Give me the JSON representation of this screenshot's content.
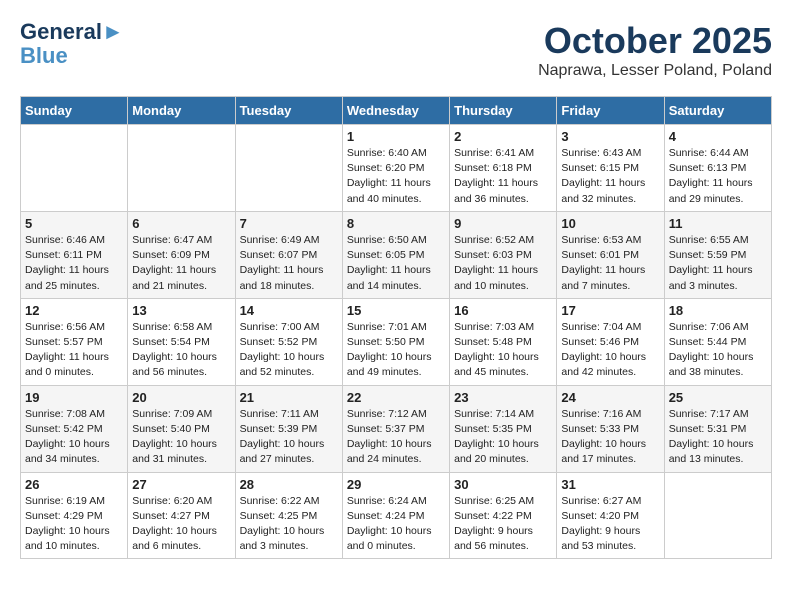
{
  "header": {
    "logo_general": "General",
    "logo_blue": "Blue",
    "month": "October 2025",
    "location": "Naprawa, Lesser Poland, Poland"
  },
  "days_of_week": [
    "Sunday",
    "Monday",
    "Tuesday",
    "Wednesday",
    "Thursday",
    "Friday",
    "Saturday"
  ],
  "weeks": [
    [
      {
        "day": "",
        "content": ""
      },
      {
        "day": "",
        "content": ""
      },
      {
        "day": "",
        "content": ""
      },
      {
        "day": "1",
        "content": "Sunrise: 6:40 AM\nSunset: 6:20 PM\nDaylight: 11 hours\nand 40 minutes."
      },
      {
        "day": "2",
        "content": "Sunrise: 6:41 AM\nSunset: 6:18 PM\nDaylight: 11 hours\nand 36 minutes."
      },
      {
        "day": "3",
        "content": "Sunrise: 6:43 AM\nSunset: 6:15 PM\nDaylight: 11 hours\nand 32 minutes."
      },
      {
        "day": "4",
        "content": "Sunrise: 6:44 AM\nSunset: 6:13 PM\nDaylight: 11 hours\nand 29 minutes."
      }
    ],
    [
      {
        "day": "5",
        "content": "Sunrise: 6:46 AM\nSunset: 6:11 PM\nDaylight: 11 hours\nand 25 minutes."
      },
      {
        "day": "6",
        "content": "Sunrise: 6:47 AM\nSunset: 6:09 PM\nDaylight: 11 hours\nand 21 minutes."
      },
      {
        "day": "7",
        "content": "Sunrise: 6:49 AM\nSunset: 6:07 PM\nDaylight: 11 hours\nand 18 minutes."
      },
      {
        "day": "8",
        "content": "Sunrise: 6:50 AM\nSunset: 6:05 PM\nDaylight: 11 hours\nand 14 minutes."
      },
      {
        "day": "9",
        "content": "Sunrise: 6:52 AM\nSunset: 6:03 PM\nDaylight: 11 hours\nand 10 minutes."
      },
      {
        "day": "10",
        "content": "Sunrise: 6:53 AM\nSunset: 6:01 PM\nDaylight: 11 hours\nand 7 minutes."
      },
      {
        "day": "11",
        "content": "Sunrise: 6:55 AM\nSunset: 5:59 PM\nDaylight: 11 hours\nand 3 minutes."
      }
    ],
    [
      {
        "day": "12",
        "content": "Sunrise: 6:56 AM\nSunset: 5:57 PM\nDaylight: 11 hours\nand 0 minutes."
      },
      {
        "day": "13",
        "content": "Sunrise: 6:58 AM\nSunset: 5:54 PM\nDaylight: 10 hours\nand 56 minutes."
      },
      {
        "day": "14",
        "content": "Sunrise: 7:00 AM\nSunset: 5:52 PM\nDaylight: 10 hours\nand 52 minutes."
      },
      {
        "day": "15",
        "content": "Sunrise: 7:01 AM\nSunset: 5:50 PM\nDaylight: 10 hours\nand 49 minutes."
      },
      {
        "day": "16",
        "content": "Sunrise: 7:03 AM\nSunset: 5:48 PM\nDaylight: 10 hours\nand 45 minutes."
      },
      {
        "day": "17",
        "content": "Sunrise: 7:04 AM\nSunset: 5:46 PM\nDaylight: 10 hours\nand 42 minutes."
      },
      {
        "day": "18",
        "content": "Sunrise: 7:06 AM\nSunset: 5:44 PM\nDaylight: 10 hours\nand 38 minutes."
      }
    ],
    [
      {
        "day": "19",
        "content": "Sunrise: 7:08 AM\nSunset: 5:42 PM\nDaylight: 10 hours\nand 34 minutes."
      },
      {
        "day": "20",
        "content": "Sunrise: 7:09 AM\nSunset: 5:40 PM\nDaylight: 10 hours\nand 31 minutes."
      },
      {
        "day": "21",
        "content": "Sunrise: 7:11 AM\nSunset: 5:39 PM\nDaylight: 10 hours\nand 27 minutes."
      },
      {
        "day": "22",
        "content": "Sunrise: 7:12 AM\nSunset: 5:37 PM\nDaylight: 10 hours\nand 24 minutes."
      },
      {
        "day": "23",
        "content": "Sunrise: 7:14 AM\nSunset: 5:35 PM\nDaylight: 10 hours\nand 20 minutes."
      },
      {
        "day": "24",
        "content": "Sunrise: 7:16 AM\nSunset: 5:33 PM\nDaylight: 10 hours\nand 17 minutes."
      },
      {
        "day": "25",
        "content": "Sunrise: 7:17 AM\nSunset: 5:31 PM\nDaylight: 10 hours\nand 13 minutes."
      }
    ],
    [
      {
        "day": "26",
        "content": "Sunrise: 6:19 AM\nSunset: 4:29 PM\nDaylight: 10 hours\nand 10 minutes."
      },
      {
        "day": "27",
        "content": "Sunrise: 6:20 AM\nSunset: 4:27 PM\nDaylight: 10 hours\nand 6 minutes."
      },
      {
        "day": "28",
        "content": "Sunrise: 6:22 AM\nSunset: 4:25 PM\nDaylight: 10 hours\nand 3 minutes."
      },
      {
        "day": "29",
        "content": "Sunrise: 6:24 AM\nSunset: 4:24 PM\nDaylight: 10 hours\nand 0 minutes."
      },
      {
        "day": "30",
        "content": "Sunrise: 6:25 AM\nSunset: 4:22 PM\nDaylight: 9 hours\nand 56 minutes."
      },
      {
        "day": "31",
        "content": "Sunrise: 6:27 AM\nSunset: 4:20 PM\nDaylight: 9 hours\nand 53 minutes."
      },
      {
        "day": "",
        "content": ""
      }
    ]
  ]
}
